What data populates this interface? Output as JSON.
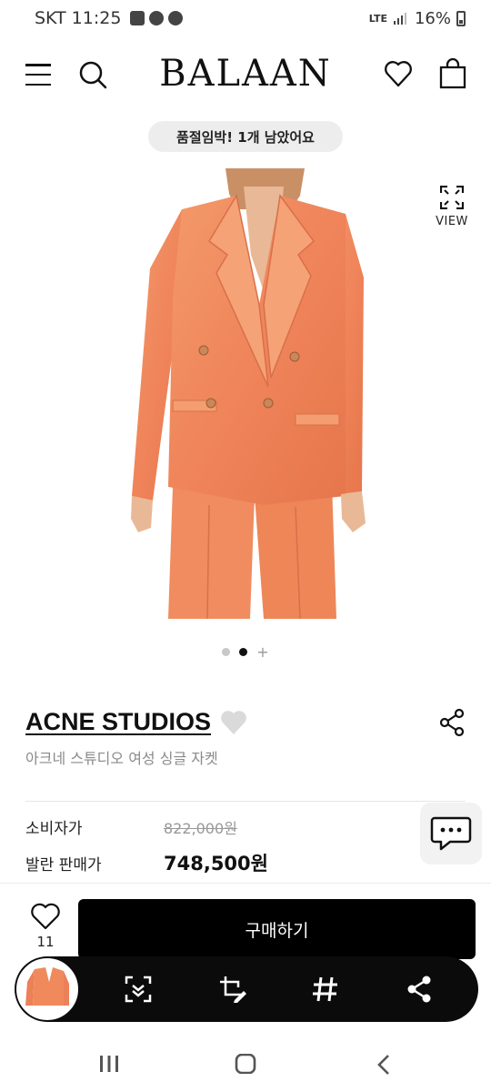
{
  "status_bar": {
    "carrier": "SKT",
    "time": "11:25",
    "network": "LTE",
    "battery": "16%"
  },
  "header": {
    "logo": "BALAAN"
  },
  "stock_banner": "품절임박! 1개 남았어요",
  "view_label": "VIEW",
  "pager": {
    "count": 2,
    "active_index": 1
  },
  "product": {
    "brand": "ACNE STUDIOS",
    "name": "아크네 스튜디오 여성 싱글 자켓",
    "jacket_color": "#f08a5d"
  },
  "prices": {
    "retail_label": "소비자가",
    "retail_value": "822,000원",
    "sale_label": "발란 판매가",
    "sale_value": "748,500원"
  },
  "wishlist": {
    "count": "11"
  },
  "buy_button": "구매하기",
  "toolbar": {
    "icons": [
      "scan-icon",
      "crop-edit-icon",
      "hashtag-icon",
      "share-icon"
    ]
  }
}
